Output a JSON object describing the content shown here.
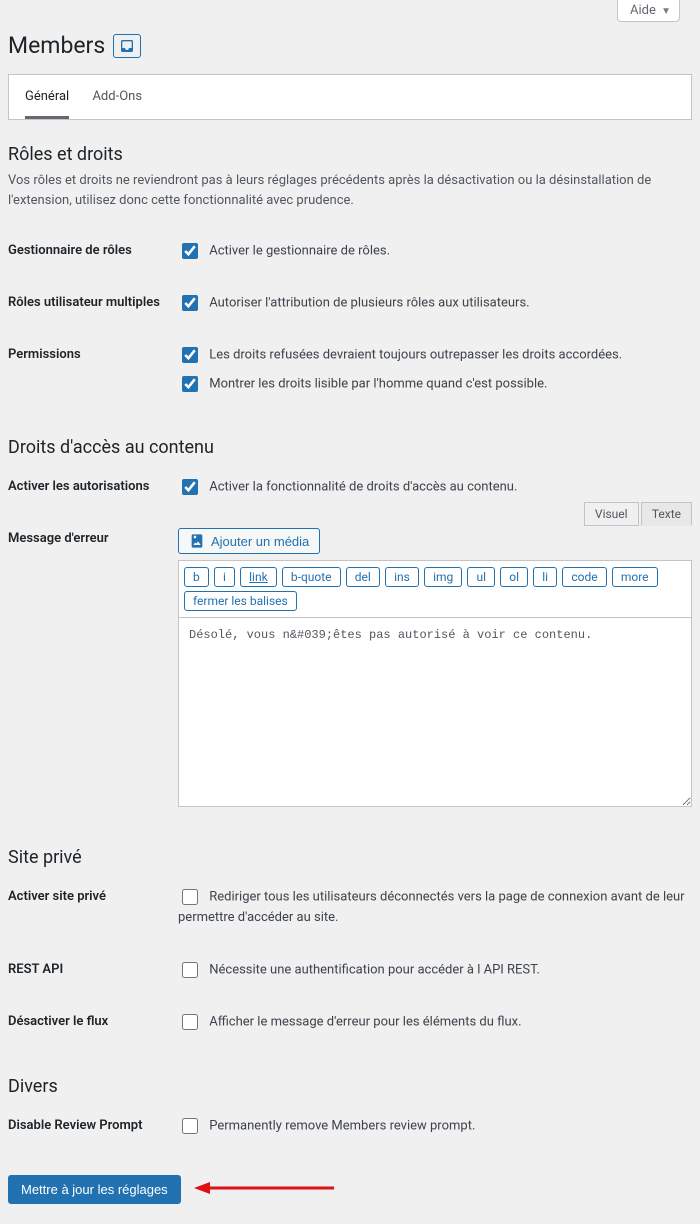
{
  "screen_meta": {
    "help": "Aide"
  },
  "page": {
    "title": "Members"
  },
  "tabs": {
    "general": "Général",
    "addons": "Add-Ons"
  },
  "sections": {
    "roles": {
      "heading": "Rôles et droits",
      "desc": "Vos rôles et droits ne reviendront pas à leurs réglages précédents après la désactivation ou la désinstallation de l'extension, utilisez donc cette fonctionnalité avec prudence.",
      "role_manager_label": "Gestionnaire de rôles",
      "role_manager_cb": "Activer le gestionnaire de rôles.",
      "multi_roles_label": "Rôles utilisateur multiples",
      "multi_roles_cb": "Autoriser l'attribution de plusieurs rôles aux utilisateurs.",
      "permissions_label": "Permissions",
      "permissions_cb1": "Les droits refusées devraient toujours outrepasser les droits accordées.",
      "permissions_cb2": "Montrer les droits lisible par l'homme quand c'est possible."
    },
    "content": {
      "heading": "Droits d'accès au contenu",
      "enable_label": "Activer les autorisations",
      "enable_cb": "Activer la fonctionnalité de droits d'accès au contenu.",
      "error_label": "Message d'erreur",
      "add_media": "Ajouter un média",
      "editor_tabs": {
        "visual": "Visuel",
        "text": "Texte"
      },
      "quicktags": [
        "b",
        "i",
        "link",
        "b-quote",
        "del",
        "ins",
        "img",
        "ul",
        "ol",
        "li",
        "code",
        "more",
        "fermer les balises"
      ],
      "textarea": "Désolé, vous n&#039;êtes pas autorisé à voir ce contenu."
    },
    "private": {
      "heading": "Site privé",
      "enable_label": "Activer site privé",
      "enable_cb": "Rediriger tous les utilisateurs déconnectés vers la page de connexion avant de leur permettre d'accéder au site.",
      "rest_label": "REST API",
      "rest_cb": "Nécessite une authentification pour accéder à l API REST.",
      "feed_label": "Désactiver le flux",
      "feed_cb": "Afficher le message d'erreur pour les éléments du flux."
    },
    "misc": {
      "heading": "Divers",
      "review_label": "Disable Review Prompt",
      "review_cb": "Permanently remove Members review prompt."
    }
  },
  "submit": "Mettre à jour les réglages"
}
